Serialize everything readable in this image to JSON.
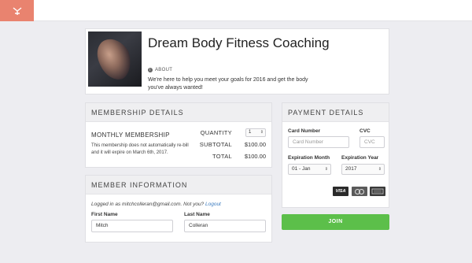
{
  "colors": {
    "brand": "#e9836f",
    "join": "#5cbf4a",
    "link": "#3b7bbf"
  },
  "profile": {
    "title": "Dream Body Fitness Coaching",
    "about_label": "ABOUT",
    "description": "We're here to help you meet your goals for 2016 and get the body you've always wanted!"
  },
  "membership": {
    "header": "MEMBERSHIP DETAILS",
    "plan_title": "MONTHLY MEMBERSHIP",
    "note": "This membership does not automatically re-bill and it will expire on March 6th, 2017.",
    "quantity_label": "QUANTITY",
    "quantity_value": "1",
    "subtotal_label": "SUBTOTAL",
    "subtotal_value": "$100.00",
    "total_label": "TOTAL",
    "total_value": "$100.00"
  },
  "member": {
    "header": "MEMBER INFORMATION",
    "logged_in_text": "Logged in as mitchcolleran@gmail.com. Not you?",
    "logout_label": "Logout",
    "first_name_label": "First Name",
    "first_name_value": "Mitch",
    "last_name_label": "Last Name",
    "last_name_value": "Colleran"
  },
  "payment": {
    "header": "PAYMENT DETAILS",
    "card_number_label": "Card Number",
    "card_number_placeholder": "Card Number",
    "cvc_label": "CVC",
    "cvc_placeholder": "CVC",
    "exp_month_label": "Expiration Month",
    "exp_month_value": "01 - Jan",
    "exp_year_label": "Expiration Year",
    "exp_year_value": "2017",
    "cards": [
      "VISA",
      "MasterCard",
      "American Express"
    ]
  },
  "join_label": "JOIN"
}
